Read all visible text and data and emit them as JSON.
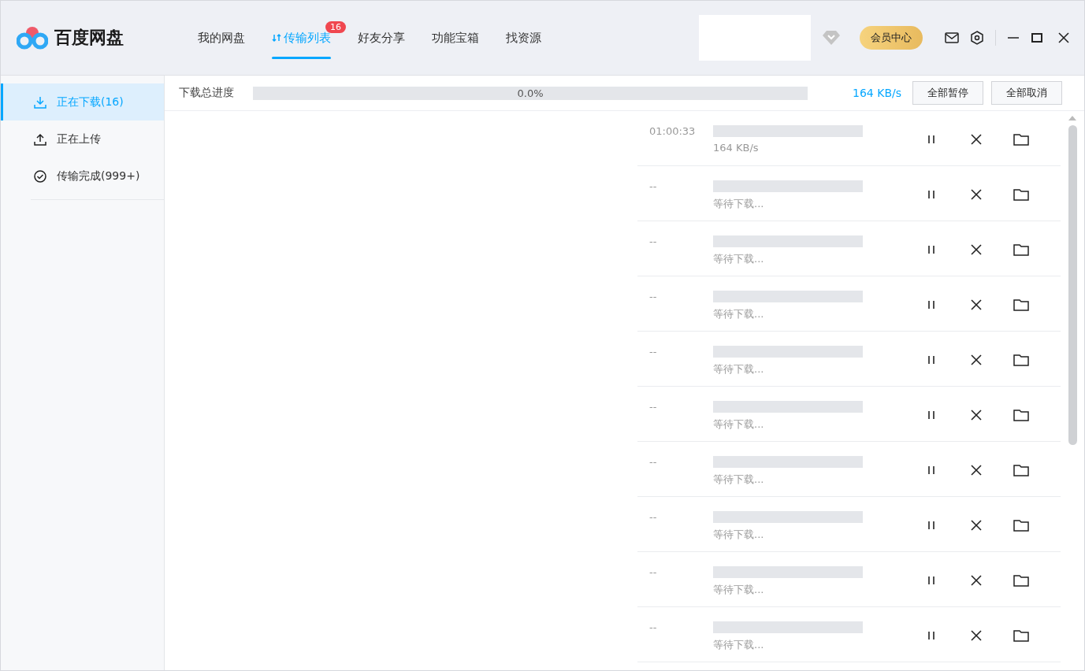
{
  "app": {
    "name": "百度网盘"
  },
  "tabs": [
    {
      "label": "我的网盘",
      "selected": false
    },
    {
      "label": "传输列表",
      "selected": true,
      "badge": "16"
    },
    {
      "label": "好友分享",
      "selected": false
    },
    {
      "label": "功能宝箱",
      "selected": false
    },
    {
      "label": "找资源",
      "selected": false
    }
  ],
  "vip_button": "会员中心",
  "sidebar": {
    "items": [
      {
        "kind": "download",
        "label": "正在下载(16)",
        "selected": true
      },
      {
        "kind": "upload",
        "label": "正在上传",
        "selected": false
      },
      {
        "kind": "done",
        "label": "传输完成(999+)",
        "selected": false
      }
    ]
  },
  "toolbar": {
    "label": "下载总进度",
    "progress": {
      "reading": "0.0%"
    },
    "speed": "164 KB/s",
    "buttons": [
      "全部暂停",
      "全部取消"
    ]
  },
  "rows": [
    {
      "time": "01:00:33",
      "status": "164 KB/s"
    },
    {
      "time": "--",
      "status": "等待下载..."
    },
    {
      "time": "--",
      "status": "等待下载..."
    },
    {
      "time": "--",
      "status": "等待下载..."
    },
    {
      "time": "--",
      "status": "等待下载..."
    },
    {
      "time": "--",
      "status": "等待下载..."
    },
    {
      "time": "--",
      "status": "等待下载..."
    },
    {
      "time": "--",
      "status": "等待下载..."
    },
    {
      "time": "--",
      "status": "等待下载..."
    },
    {
      "time": "--",
      "status": "等待下载..."
    }
  ]
}
